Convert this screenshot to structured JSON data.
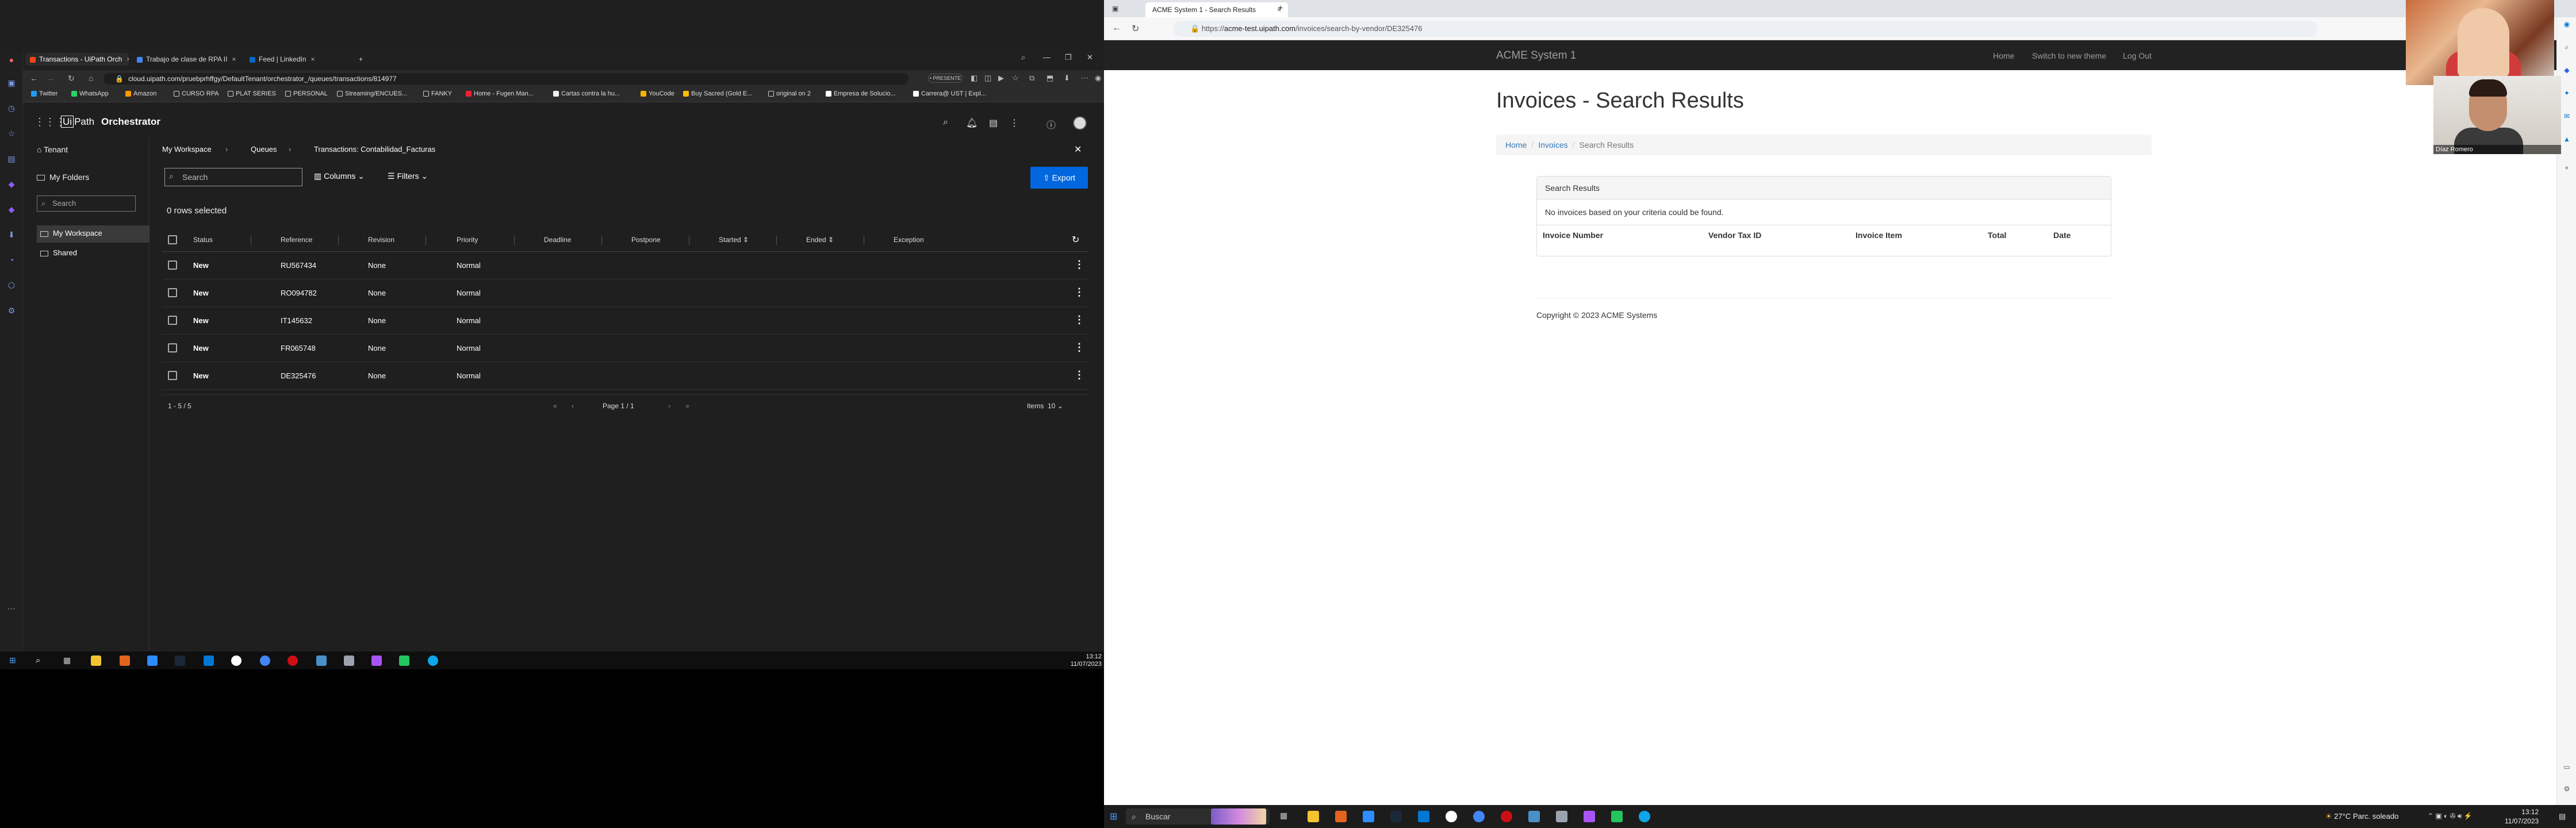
{
  "left_browser": {
    "tabs": [
      {
        "label": "Transactions - UiPath Orch",
        "icon_color": "#fa4616",
        "active": true
      },
      {
        "label": "Trabajo de clase de RPA II",
        "icon_color": "#4285f4",
        "active": false
      },
      {
        "label": "Feed | LinkedIn",
        "icon_color": "#0a66c2",
        "active": false
      }
    ],
    "url": "cloud.uipath.com/pruebprhffgy/DefaultTenant/orchestrator_/queues/transactions/814977",
    "status_pill": "• PRESENTE",
    "bookmarks": [
      "Twitter",
      "WhatsApp",
      "Amazon",
      "CURSO RPA",
      "PLAT SERIES",
      "PERSONAL",
      "Streaming/ENCUES...",
      "FANKY",
      "Home - Fugen Man...",
      "Cartas contra la hu...",
      "YouCode",
      "Buy Sacred (Gold E...",
      "original on 2",
      "Empresa de Solucio...",
      "Carrera@ UST | Expl..."
    ]
  },
  "orchestrator": {
    "logo_box": "Ui",
    "logo_text": "Path",
    "product": "Orchestrator",
    "sidebar": {
      "tenant": "Tenant",
      "my_folders": "My Folders",
      "search_placeholder": "Search",
      "my_workspace": "My Workspace",
      "shared": "Shared"
    },
    "breadcrumb": [
      "My Workspace",
      "Queues",
      "Transactions: Contabilidad_Facturas"
    ],
    "search_placeholder": "Search",
    "columns_label": "Columns",
    "filters_label": "Filters",
    "export_label": "Export",
    "rows_selected": "0 rows selected",
    "columns": [
      "Status",
      "Reference",
      "Revision",
      "Priority",
      "Deadline",
      "Postpone",
      "Started",
      "Ended",
      "Exception"
    ],
    "rows": [
      {
        "status": "New",
        "reference": "RU567434",
        "revision": "None",
        "priority": "Normal"
      },
      {
        "status": "New",
        "reference": "RO094782",
        "revision": "None",
        "priority": "Normal"
      },
      {
        "status": "New",
        "reference": "IT145632",
        "revision": "None",
        "priority": "Normal"
      },
      {
        "status": "New",
        "reference": "FR065748",
        "revision": "None",
        "priority": "Normal"
      },
      {
        "status": "New",
        "reference": "DE325476",
        "revision": "None",
        "priority": "Normal"
      }
    ],
    "pagination": {
      "range": "1 - 5 / 5",
      "page": "Page 1 / 1",
      "items_label": "Items",
      "items_value": "10"
    }
  },
  "left_taskbar": {
    "time": "13:12",
    "date": "11/07/2023"
  },
  "right_browser": {
    "tab_label": "ACME System 1 - Search Results",
    "url_scheme": "https://",
    "url_host": "acme-test.uipath.com",
    "url_path": "/invoices/search-by-vendor/DE325476"
  },
  "acme": {
    "brand": "ACME System 1",
    "nav": [
      "Home",
      "Switch to new theme",
      "Log Out"
    ],
    "title": "Invoices - Search Results",
    "breadcrumb": [
      "Home",
      "Invoices",
      "Search Results"
    ],
    "panel_title": "Search Results",
    "empty_message": "No invoices based on your criteria could be found.",
    "columns": [
      "Invoice Number",
      "Vendor Tax ID",
      "Invoice Item",
      "Total",
      "Date"
    ],
    "copyright": "Copyright © 2023 ACME Systems"
  },
  "webcam": {
    "participant_name": "Díaz Romero"
  },
  "right_taskbar": {
    "search_placeholder": "Buscar",
    "weather": "27°C  Parc. soleado",
    "time": "13:12",
    "date": "11/07/2023"
  }
}
